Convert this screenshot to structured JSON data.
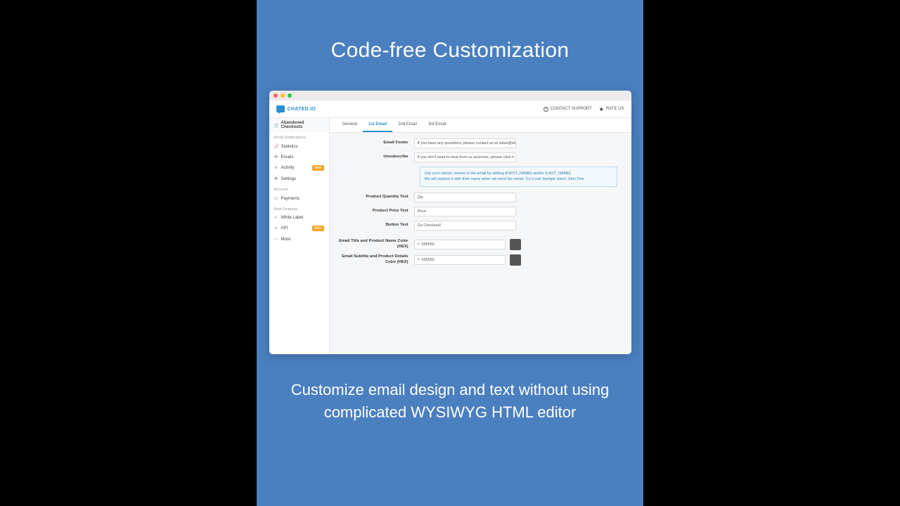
{
  "promo": {
    "heading": "Code-free Customization",
    "subtext": "Customize email design and text without using complicated WYSIWYG HTML editor"
  },
  "brand": {
    "name": "CHATED.IO"
  },
  "top_actions": {
    "support": "CONTACT SUPPORT",
    "rate": "RATE US"
  },
  "sidebar": {
    "primary": "Abandoned Checkouts",
    "sections": {
      "notifications_header": "Email Notifications",
      "account_header": "Account",
      "features_header": "New Features"
    },
    "items": {
      "statistics": "Statistics",
      "emails": "Emails",
      "activity": "Activity",
      "settings": "Settings",
      "payments": "Payments",
      "whitelabel": "White Label",
      "api": "API",
      "more": "More"
    },
    "badges": {
      "new": "New",
      "beta": "Beta"
    }
  },
  "tabs": {
    "general": "General",
    "first": "1st Email",
    "second": "2nd Email",
    "third": "3rd Email"
  },
  "form": {
    "labels": {
      "footer": "Email Footer",
      "unsubscribe": "Unsubscribe",
      "qty": "Product Quantity Text",
      "price": "Product Price Text",
      "button": "Button Text",
      "title_color": "Email Title and Product Name Color (HEX)",
      "subtitle_color": "Email Subtitle and Product Details Color (HEX)"
    },
    "values": {
      "footer": "If you have any questions, please contact us at sales@stu",
      "unsubscribe": "If you don't want to hear from us anymore, please click h",
      "qty": "Qty",
      "price": "Price",
      "button": "Go Checkout!",
      "title_color": "555555",
      "subtitle_color": "555555"
    },
    "tip": {
      "line1": "Use your clients' names in the email by adding {FIRST_NAME} and/or {LAST_NAME}.",
      "line2": "We will replace it with their name when we send the email. Try it out! Sample client: John Doe"
    },
    "hex_prefix": "#",
    "swatch_color": "#555555"
  }
}
